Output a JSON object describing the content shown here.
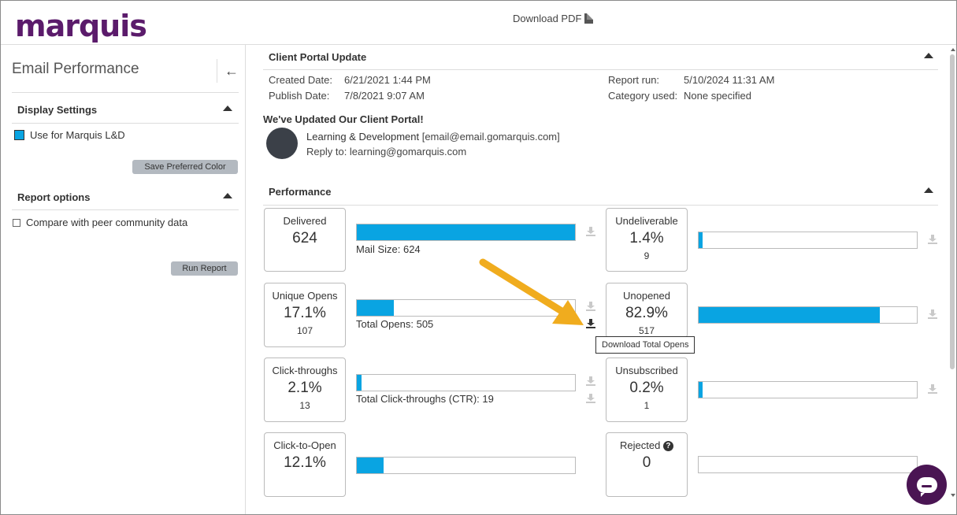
{
  "header": {
    "logo_text": "marquis",
    "download_pdf_label": "Download PDF"
  },
  "sidebar": {
    "title": "Email Performance",
    "display_settings": {
      "heading": "Display Settings",
      "color_option_label": "Use for Marquis L&D",
      "color_swatch": "#09a4e2",
      "save_button_label": "Save Preferred Color"
    },
    "report_options": {
      "heading": "Report options",
      "compare_label": "Compare with peer community data",
      "compare_checked": false,
      "run_button_label": "Run Report"
    }
  },
  "report": {
    "title": "Client Portal Update",
    "created_label": "Created Date:",
    "created_value": "6/21/2021 1:44 PM",
    "published_label": "Publish Date:",
    "published_value": "7/8/2021 9:07 AM",
    "run_label": "Report run:",
    "run_value": "5/10/2024 11:31 AM",
    "category_label": "Category used:",
    "category_value": "None specified",
    "email_subject": "We've Updated Our Client Portal!",
    "sender_name": "Learning & Development",
    "sender_email": "[email@email.gomarquis.com]",
    "reply_to": "Reply to: learning@gomarquis.com"
  },
  "performance": {
    "heading": "Performance",
    "accent_color": "#09a4e2",
    "metrics_left": [
      {
        "label": "Delivered",
        "value": "624",
        "sub": "",
        "bar_fraction": 1.0,
        "caption": "Mail Size: 624"
      },
      {
        "label": "Unique Opens",
        "value": "17.1%",
        "sub": "107",
        "bar_fraction": 0.171,
        "caption": "Total Opens: 505"
      },
      {
        "label": "Click-throughs",
        "value": "2.1%",
        "sub": "13",
        "bar_fraction": 0.021,
        "caption": "Total Click-throughs (CTR): 19"
      },
      {
        "label": "Click-to-Open",
        "value": "12.1%",
        "sub": "",
        "bar_fraction": 0.121,
        "caption": ""
      }
    ],
    "metrics_right": [
      {
        "label": "Undeliverable",
        "value": "1.4%",
        "sub": "9",
        "bar_fraction": 0.014
      },
      {
        "label": "Unopened",
        "value": "82.9%",
        "sub": "517",
        "bar_fraction": 0.829
      },
      {
        "label": "Unsubscribed",
        "value": "0.2%",
        "sub": "1",
        "bar_fraction": 0.002
      },
      {
        "label": "Rejected",
        "value": "0",
        "sub": "",
        "bar_fraction": 0.0
      }
    ],
    "tooltip": "Download Total Opens"
  }
}
